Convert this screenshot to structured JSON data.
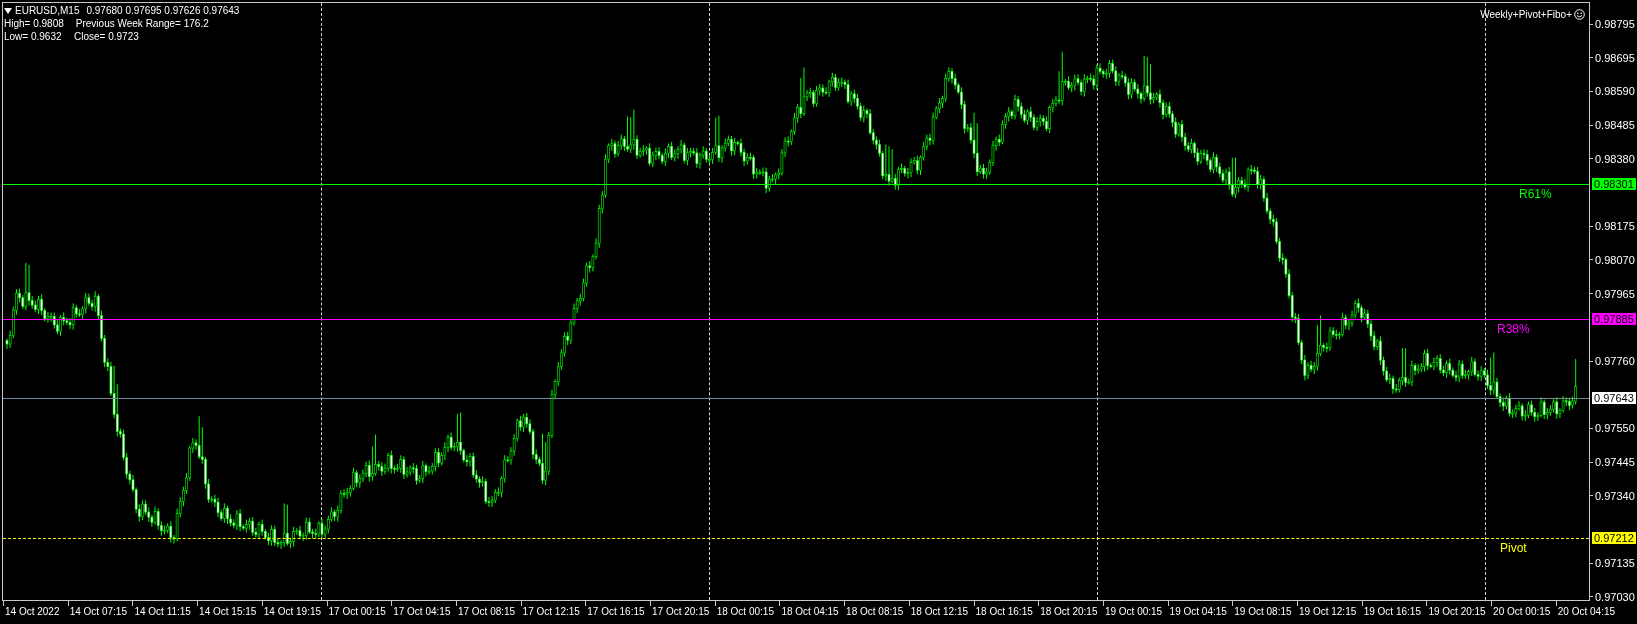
{
  "header": {
    "symbol": "EURUSD,M15",
    "prices": "0.97680 0.97695 0.97626 0.97643",
    "rows": [
      [
        "High= 0.9808",
        "Previous Week Range= 176.2"
      ],
      [
        "Low= 0.9632",
        "Close= 0.9723"
      ]
    ]
  },
  "indicator_label": "Weekly+Pivot+Fibo+",
  "price_axis": {
    "ticks": [
      "0.98795",
      "0.98695",
      "0.98590",
      "0.98485",
      "0.98380",
      "0.98175",
      "0.98070",
      "0.97965",
      "0.97760",
      "0.97550",
      "0.97445",
      "0.97340",
      "0.97135",
      "0.97030"
    ]
  },
  "levels": [
    {
      "kind": "solid",
      "label": "R61%",
      "price": "0.98301",
      "color": "#00ff00"
    },
    {
      "kind": "solid",
      "label": "R38%",
      "price": "0.97885",
      "color": "#ff00ff"
    },
    {
      "kind": "current",
      "price": "0.97643",
      "color": "#778899"
    },
    {
      "kind": "dashdot",
      "label": "Pivot",
      "price": "0.97212",
      "color": "#ffff00"
    }
  ],
  "time_axis": {
    "labels": [
      "14 Oct 2022",
      "14 Oct 07:15",
      "14 Oct 11:15",
      "14 Oct 15:15",
      "14 Oct 19:15",
      "17 Oct 00:15",
      "17 Oct 04:15",
      "17 Oct 08:15",
      "17 Oct 12:15",
      "17 Oct 16:15",
      "17 Oct 20:15",
      "18 Oct 00:15",
      "18 Oct 04:15",
      "18 Oct 08:15",
      "18 Oct 12:15",
      "18 Oct 16:15",
      "18 Oct 20:15",
      "19 Oct 00:15",
      "19 Oct 04:15",
      "19 Oct 08:15",
      "19 Oct 12:15",
      "19 Oct 16:15",
      "19 Oct 20:15",
      "20 Oct 00:15",
      "20 Oct 04:15"
    ]
  }
}
